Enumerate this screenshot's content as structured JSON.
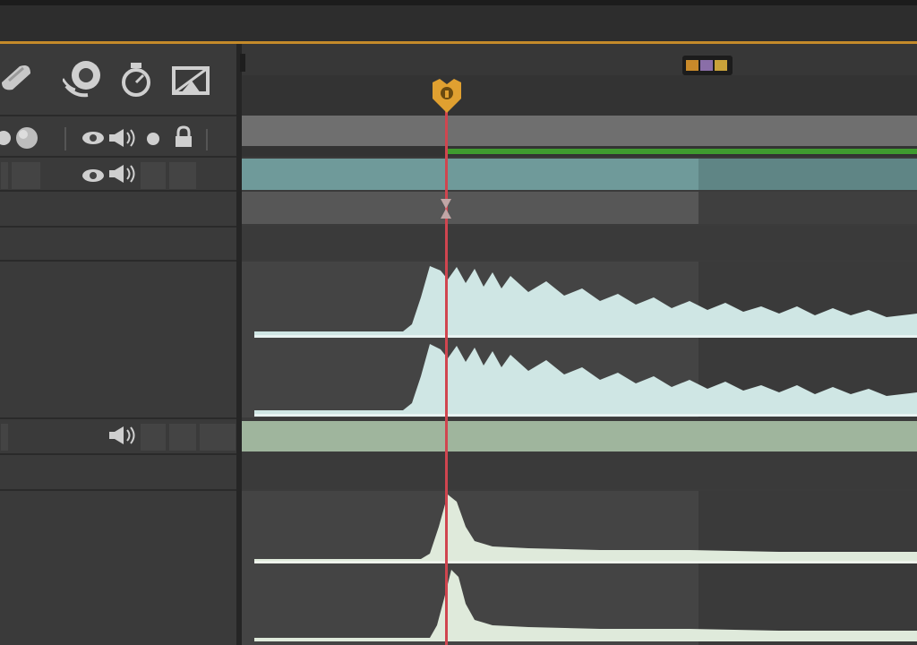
{
  "colors": {
    "accent_orange": "#e0a030",
    "playhead_red": "#d0454f",
    "audio_layer_blue": "#6f9a9a",
    "audio_waveform": "#cfe6e4",
    "work_area_green": "#3f9b2f",
    "audio_layer2_green": "#9fb59d",
    "waveform_green": "#dfeadb"
  },
  "toolbar": {
    "icons": [
      "draft-3d-icon",
      "motion-blur-icon",
      "graph-editor-icon",
      "frame-blending-icon"
    ]
  },
  "layer_switches": {
    "header_icons": [
      "video-eye-icon",
      "audio-speaker-icon",
      "solo-dot-icon",
      "lock-icon"
    ]
  },
  "timeline": {
    "playhead_marker": "current-time-indicator",
    "composition_markers": [
      "orange",
      "purple",
      "yellow"
    ],
    "layers": [
      {
        "id": "audio-layer-1",
        "type": "audio",
        "has_video_switch": true,
        "has_audio_switch": true
      },
      {
        "id": "audio-layer-2",
        "type": "audio",
        "has_video_switch": false,
        "has_audio_switch": true
      }
    ]
  }
}
